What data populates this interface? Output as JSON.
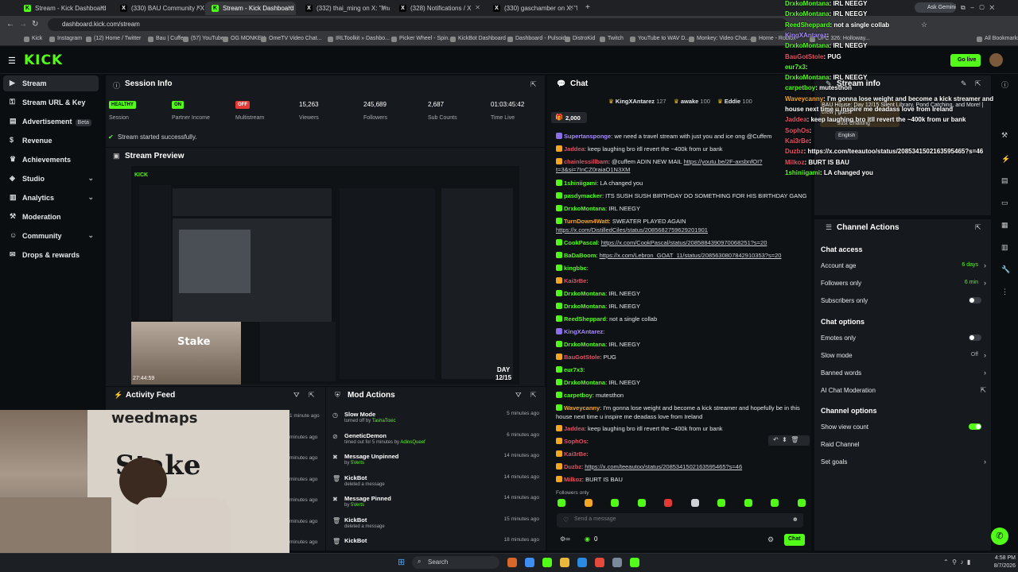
{
  "browser": {
    "tabs": [
      {
        "label": "Stream - Kick Dashboard",
        "icon": "kick-icon",
        "active": false
      },
      {
        "label": "(330) BAU Community / X",
        "icon": "x-icon",
        "active": false
      },
      {
        "label": "Stream - Kick Dashboard",
        "icon": "kick-icon",
        "active": true
      },
      {
        "label": "(332) thai_ming on X: \"Imag",
        "icon": "x-icon",
        "active": false
      },
      {
        "label": "(328) Notifications / X",
        "icon": "x-icon",
        "active": false
      },
      {
        "label": "(330) gaschamber on X: \"https:",
        "icon": "x-icon",
        "active": false
      }
    ],
    "url": "dashboard.kick.com/stream",
    "ask_gemini": "Ask Gemini",
    "bookmarks": [
      "Kick",
      "Instagram",
      "(12) Home / Twitter",
      "Bau | Cuffem",
      "(57) YouTube",
      "OG MONKEY",
      "OmeTV Video Chat...",
      "IRLToolkit » Dashbo...",
      "Picker Wheel - Spin...",
      "KickBot Dashboard",
      "Dashboard - Pulsoid",
      "DistroKid",
      "Twitch",
      "YouTube to WAV D...",
      "Monkey: Video Chat...",
      "Home - Roblox",
      "UFC 326: Holloway...",
      "All Bookmarks"
    ]
  },
  "kick": {
    "logo": "KICK",
    "go_live": "Go live"
  },
  "sidebar": {
    "items": [
      {
        "label": "Stream",
        "icon": "play-icon",
        "active": true,
        "chev": false
      },
      {
        "label": "Stream URL & Key",
        "icon": "key-icon",
        "active": false,
        "chev": false
      },
      {
        "label": "Advertisement",
        "icon": "ad-icon",
        "active": false,
        "chev": false,
        "beta": "Beta"
      },
      {
        "label": "Revenue",
        "icon": "dollar-icon",
        "active": false,
        "chev": false
      },
      {
        "label": "Achievements",
        "icon": "trophy-icon",
        "active": false,
        "chev": false
      },
      {
        "label": "Studio",
        "icon": "studio-icon",
        "active": false,
        "chev": true
      },
      {
        "label": "Analytics",
        "icon": "chart-icon",
        "active": false,
        "chev": true
      },
      {
        "label": "Moderation",
        "icon": "hammer-icon",
        "active": false,
        "chev": false
      },
      {
        "label": "Community",
        "icon": "users-icon",
        "active": false,
        "chev": true
      },
      {
        "label": "Drops & rewards",
        "icon": "gift-icon",
        "active": false,
        "chev": false
      }
    ]
  },
  "session": {
    "title": "Session Info",
    "stats": [
      {
        "value": "HEALTHY",
        "label": "Session",
        "color": "#53fc18",
        "badge": true
      },
      {
        "value": "ON",
        "label": "Partner Income",
        "color": "#53fc18",
        "badge": true
      },
      {
        "value": "OFF",
        "label": "Multistream",
        "color": "#e53935",
        "badge": true
      },
      {
        "value": "15,263",
        "label": "Viewers",
        "badge": false
      },
      {
        "value": "245,689",
        "label": "Followers",
        "badge": false
      },
      {
        "value": "2,687",
        "label": "Sub Counts",
        "badge": false
      },
      {
        "value": "01:03:45:42",
        "label": "Time Live",
        "badge": false
      }
    ],
    "status": "Stream started successfully."
  },
  "preview": {
    "title": "Stream Preview",
    "overlay_top": "27:44:59",
    "overlay_day": "DAY",
    "overlay_date": "12/15"
  },
  "activity": {
    "title": "Activity Feed",
    "times": [
      "1 minute ago",
      "minutes ago",
      "minutes ago",
      "minutes ago",
      "minutes ago",
      "minutes ago",
      "minutes ago"
    ]
  },
  "mod": {
    "title": "Mod Actions",
    "rows": [
      {
        "title": "Slow Mode",
        "sub": "turned off by",
        "who": "TashaToxic",
        "time": "5 minutes ago",
        "icon": "clock-icon"
      },
      {
        "title": "GeneticDemon",
        "sub": "timed out for 5 minutes by",
        "who": "AdinsQueef",
        "time": "6 minutes ago",
        "icon": "timeout-icon"
      },
      {
        "title": "Message Unpinned",
        "sub": "by",
        "who": "5Verts",
        "time": "14 minutes ago",
        "icon": "pin-icon"
      },
      {
        "title": "KickBot",
        "sub": "deleted a message",
        "who": "",
        "time": "14 minutes ago",
        "icon": "trash-icon"
      },
      {
        "title": "Message Pinned",
        "sub": "by",
        "who": "5Verts",
        "time": "14 minutes ago",
        "icon": "pin-icon"
      },
      {
        "title": "KickBot",
        "sub": "deleted a message",
        "who": "",
        "time": "15 minutes ago",
        "icon": "trash-icon"
      },
      {
        "title": "KickBot",
        "sub": "",
        "who": "",
        "time": "18 minutes ago",
        "icon": "trash-icon"
      }
    ]
  },
  "chat": {
    "title": "Chat",
    "top_gifters": [
      {
        "name": "KingXAntarez",
        "count": "127"
      },
      {
        "name": "awake",
        "count": "100"
      },
      {
        "name": "Eddie",
        "count": "100"
      }
    ],
    "pinned_count": "2,000",
    "messages": [
      {
        "user": "Supertansponge",
        "color": "#a78bfa",
        "text": "we need a travel stream with just you and ice ong @Cuffem",
        "link": false
      },
      {
        "user": "Jaddea",
        "color": "#e05263",
        "text": "keep laughing bro itll revert the ~400k from ur bank",
        "link": false
      },
      {
        "user": "chainlessillbam",
        "color": "#e05263",
        "text": "@cuffem ADIN NEW MAIL ",
        "linktext": "https://youtu.be/2F-axsbnfOI?",
        "link": true
      },
      {
        "user": "",
        "color": "#53fc18",
        "text": "",
        "linktext": "t=3&si=7InCZ0raiaO1N3XM",
        "link": true
      },
      {
        "user": "1shiniigami",
        "color": "#53fc18",
        "text": "LA changed you",
        "link": false
      },
      {
        "user": "pasdymacker",
        "color": "#53fc18",
        "text": "ITS SUSH SUSH BIRTHDAY DO SOMETHING FOR HIS BIRTHDAY GANG",
        "link": false
      },
      {
        "user": "DrxkoMontana",
        "color": "#53fc18",
        "text": "IRL NEEGY",
        "link": false
      },
      {
        "user": "TurnDown4Watt",
        "color": "#f5a623",
        "text": "SWEATER PLAYED AGAIN",
        "link": false
      },
      {
        "user": "",
        "color": "#53fc18",
        "text": "",
        "linktext": "https://x.com/DistilledCiles/status/2085682759629201901",
        "link": true
      },
      {
        "user": "CookPascal",
        "color": "#53fc18",
        "text": "",
        "linktext": "https://x.com/CookPascal/status/2085884390970068251?s=20",
        "link": true
      },
      {
        "user": "BaDaBoom",
        "color": "#53fc18",
        "text": "",
        "linktext": "https://x.com/Lebron_GOAT_11/status/2085630807842910353?s=20",
        "link": true
      },
      {
        "user": "kingbbc",
        "color": "#53fc18",
        "text": "",
        "link": false
      },
      {
        "user": "Kai3rBe",
        "color": "#e05263",
        "text": "",
        "link": false
      },
      {
        "user": "DrxkoMontana",
        "color": "#53fc18",
        "text": "IRL NEEGY",
        "link": false
      },
      {
        "user": "DrxkoMontana",
        "color": "#53fc18",
        "text": "IRL NEEGY",
        "link": false
      },
      {
        "user": "ReedSheppard",
        "color": "#53fc18",
        "text": "not a single collab",
        "link": false
      },
      {
        "user": "KingXAntarez",
        "color": "#a78bfa",
        "text": "",
        "link": false
      },
      {
        "user": "DrxkoMontana",
        "color": "#53fc18",
        "text": "IRL NEEGY",
        "link": false
      },
      {
        "user": "BauGotStole",
        "color": "#e05263",
        "text": "PUG",
        "link": false
      },
      {
        "user": "eur7x3",
        "color": "#53fc18",
        "text": "",
        "link": false
      },
      {
        "user": "DrxkoMontana",
        "color": "#53fc18",
        "text": "IRL NEEGY",
        "link": false
      },
      {
        "user": "carpetboy",
        "color": "#53fc18",
        "text": "mutesthon",
        "link": false
      },
      {
        "user": "Waveycanny",
        "color": "#f5a623",
        "text": "I'm gonna lose weight and become a kick streamer and hopefully be in this",
        "link": false
      },
      {
        "user": "",
        "color": "#53fc18",
        "text": "house next time u inspire me deadass love from Ireland",
        "link": false
      },
      {
        "user": "Jaddea",
        "color": "#e05263",
        "text": "keep laughing bro itll revert the ~400k from ur bank",
        "link": false
      },
      {
        "user": "SophOs",
        "color": "#e05263",
        "text": "",
        "link": false
      },
      {
        "user": "Kai3rBe",
        "color": "#e05263",
        "text": "",
        "link": false
      },
      {
        "user": "Duzbz",
        "color": "#e05263",
        "text": "",
        "linktext": "https://x.com/teeautoo/status/2085341502163595465?s=46",
        "link": true
      },
      {
        "user": "Milkoz",
        "color": "#e05263",
        "text": "BURT IS BAU",
        "link": false
      }
    ],
    "followers_only": "Followers only",
    "placeholder": "Send a message",
    "count": "0",
    "send": "Chat"
  },
  "stream_info": {
    "title": "Stream info",
    "stream_title": "BAU House: Day 12/15 Silent Library, Pond Catching, and More! | crew | guest",
    "category": "Just Chatting",
    "language": "English"
  },
  "overlay_chat": [
    {
      "user": "DrxkoMontana",
      "text": "IRL NEEGY",
      "color": "#53fc18"
    },
    {
      "user": "DrxkoMontana",
      "text": "IRL NEEGY",
      "color": "#53fc18"
    },
    {
      "user": "ReedSheppard",
      "text": "not a single collab",
      "color": "#53fc18"
    },
    {
      "user": "KingXAntarez",
      "text": "",
      "color": "#a78bfa"
    },
    {
      "user": "DrxkoMontana",
      "text": "IRL NEEGY",
      "color": "#53fc18"
    },
    {
      "user": "BauGotStole",
      "text": "PUG",
      "color": "#e05263"
    },
    {
      "user": "eur7x3",
      "text": "",
      "color": "#53fc18"
    },
    {
      "user": "DrxkoMontana",
      "text": "IRL NEEGY",
      "color": "#53fc18"
    },
    {
      "user": "carpetboy",
      "text": "mutesthon",
      "color": "#53fc18"
    },
    {
      "user": "Waveycanny",
      "text": "I'm gonna lose weight and become a kick streamer and hopefully be in this",
      "color": "#f5a623"
    },
    {
      "user": "",
      "text": "house next time u inspire me deadass love from Ireland",
      "color": "#fff"
    },
    {
      "user": "Jaddea",
      "text": "keep laughing bro itll revert the ~400k from ur bank",
      "color": "#e05263"
    },
    {
      "user": "SophOs",
      "text": "",
      "color": "#e05263"
    },
    {
      "user": "Kai3rBe",
      "text": "",
      "color": "#e05263"
    },
    {
      "user": "Duzbz",
      "text": "https://x.com/teeautoo/status/2085341502163595465?s=46",
      "color": "#e05263"
    },
    {
      "user": "Milkoz",
      "text": "BURT IS BAU",
      "color": "#e05263"
    },
    {
      "user": "1shiniigami",
      "text": "LA changed you",
      "color": "#53fc18"
    }
  ],
  "channel_actions": {
    "title": "Channel Actions",
    "chat_access": "Chat access",
    "account_age": {
      "label": "Account age",
      "value": "6 days"
    },
    "followers_only": {
      "label": "Followers only",
      "value": "6 min"
    },
    "subscribers_only": "Subscribers only",
    "chat_options": "Chat options",
    "emotes_only": "Emotes only",
    "slow_mode": {
      "label": "Slow mode",
      "value": "Off"
    },
    "banned_words": "Banned words",
    "ai_mod": "AI Chat Moderation",
    "channel_options": "Channel options",
    "show_view_count": "Show view count",
    "raid_channel": "Raid Channel",
    "set_goals": "Set goals"
  },
  "taskbar": {
    "search": "Search",
    "time": "4:58 PM",
    "date": "8/7/2026"
  },
  "webcam": {
    "banner1": "weedmaps",
    "banner2": "Stake"
  }
}
